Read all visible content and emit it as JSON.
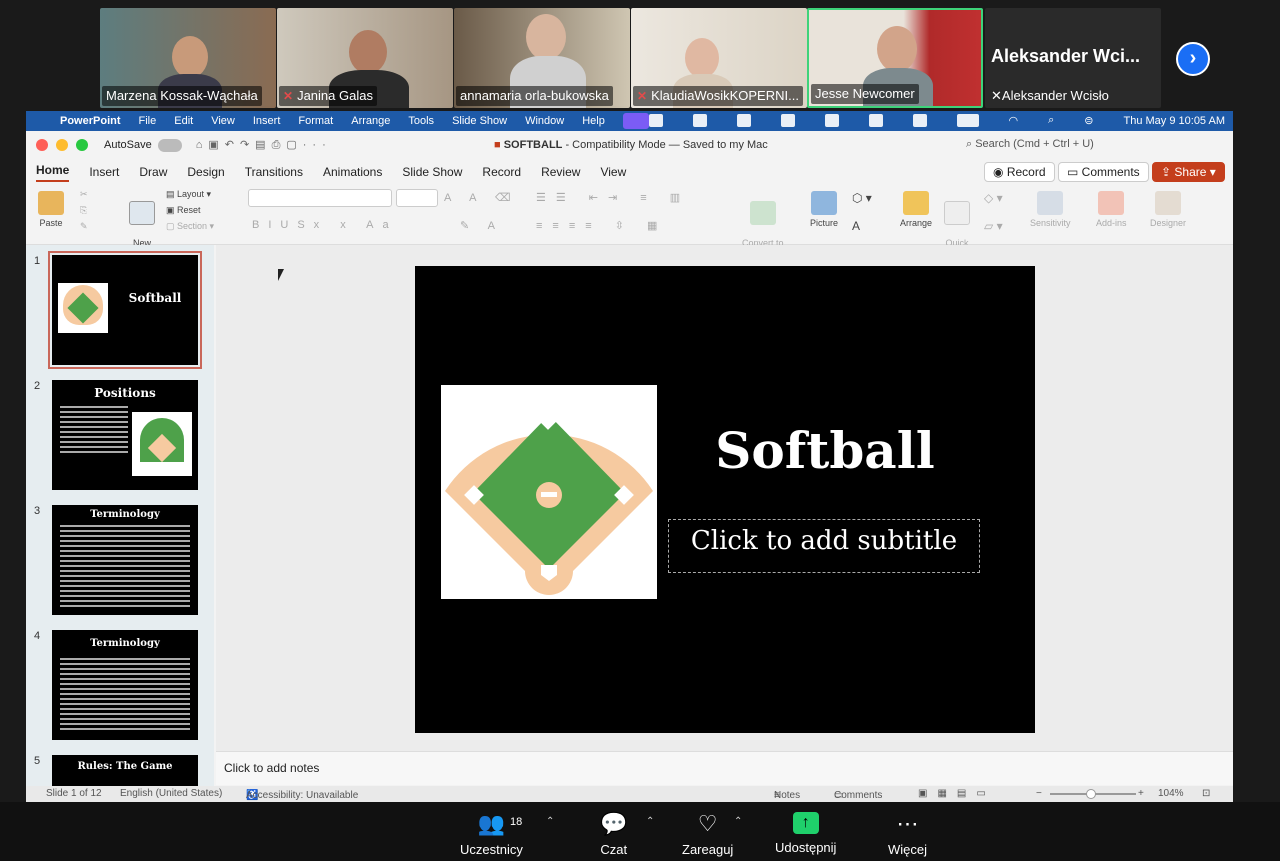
{
  "participants": [
    {
      "name": "Marzena Kossak-Wąchała",
      "muted": false
    },
    {
      "name": "Janina Galas",
      "muted": true
    },
    {
      "name": "annamaria orla-bukowska",
      "muted": false
    },
    {
      "name": "KlaudiaWosikKOPERNI...",
      "muted": true
    },
    {
      "name": "Jesse Newcomer",
      "muted": false,
      "active": true
    }
  ],
  "name_only_tile": {
    "big": "Aleksander  Wci...",
    "name": "Aleksander Wcisło",
    "muted": true
  },
  "menubar": {
    "app": "PowerPoint",
    "items": [
      "File",
      "Edit",
      "View",
      "Insert",
      "Format",
      "Arrange",
      "Tools",
      "Slide Show",
      "Window",
      "Help"
    ],
    "datetime": "Thu May 9  10:05 AM"
  },
  "titlebar": {
    "autosave": "AutoSave",
    "doc_name": "SOFTBALL",
    "doc_mode": "-  Compatibility Mode  — Saved to my Mac",
    "search": "Search (Cmd + Ctrl + U)"
  },
  "tabs": [
    "Home",
    "Insert",
    "Draw",
    "Design",
    "Transitions",
    "Animations",
    "Slide Show",
    "Record",
    "Review",
    "View"
  ],
  "tab_buttons": {
    "record": "Record",
    "comments": "Comments",
    "share": "Share"
  },
  "ribbon": {
    "paste": "Paste",
    "new_slide": "New\nSlide",
    "layout": "Layout",
    "reset": "Reset",
    "section": "Section",
    "convert": "Convert to\nSmartArt",
    "picture": "Picture",
    "arrange": "Arrange",
    "quick_styles": "Quick\nStyles",
    "sensitivity": "Sensitivity",
    "addins": "Add-ins",
    "designer": "Designer"
  },
  "thumbnails": [
    {
      "num": "1",
      "title": "Softball"
    },
    {
      "num": "2",
      "title": "Positions"
    },
    {
      "num": "3",
      "title": "Terminology"
    },
    {
      "num": "4",
      "title": "Terminology"
    },
    {
      "num": "5",
      "title": "Rules: The Game"
    }
  ],
  "slide": {
    "title": "Softball",
    "subtitle": "Click to add subtitle"
  },
  "notes": "Click to add notes",
  "status": {
    "slide": "Slide 1 of 12",
    "lang": "English (United States)",
    "accessibility": "Accessibility: Unavailable",
    "notes": "Notes",
    "comments": "Comments",
    "zoom": "104%"
  },
  "zoom_bar": {
    "participants": "Uczestnicy",
    "participants_count": "18",
    "chat": "Czat",
    "react": "Zareaguj",
    "share": "Udostępnij",
    "more": "Więcej"
  },
  "colors": {
    "accent": "#c43e1c",
    "active_speaker": "#3ed37a",
    "menubar": "#1e5aa8",
    "share_green": "#1fd06b"
  }
}
